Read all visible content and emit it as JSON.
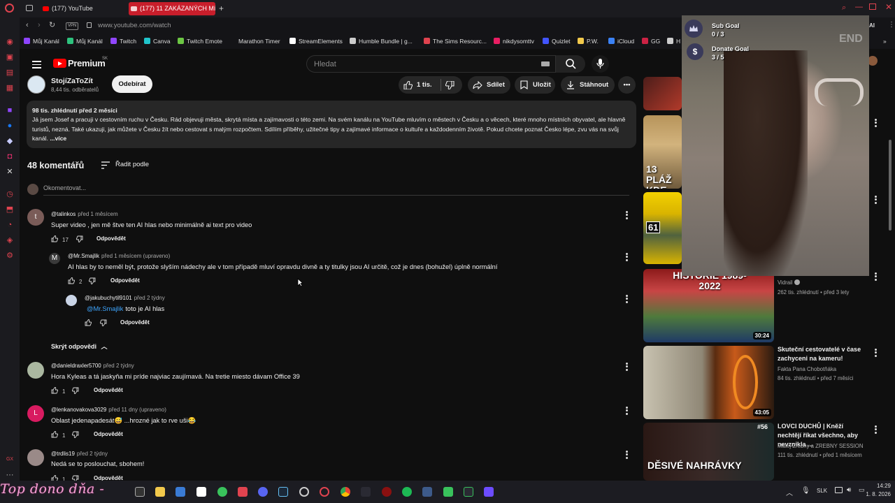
{
  "tabs": [
    {
      "label": "(177) YouTube"
    },
    {
      "label": "(177) 11 ZAKÁZANÝCH Míst"
    }
  ],
  "address": {
    "vpn": "VPN",
    "url": "www.youtube.com/watch",
    "ai": "AI"
  },
  "bookmarks": [
    {
      "label": "Můj Kanál",
      "color": "#8e44ff"
    },
    {
      "label": "Můj Kanál",
      "color": "#2ec27e"
    },
    {
      "label": "Twitch",
      "color": "#9146ff"
    },
    {
      "label": "Canva",
      "color": "#20c4cb"
    },
    {
      "label": "Twitch Emote",
      "color": "#6cc644"
    },
    {
      "label": "Marathon Timer",
      "color": "#141417"
    },
    {
      "label": "StreamElements",
      "color": "#ffffff"
    },
    {
      "label": "Humble Bundle | g...",
      "color": "#cccccc"
    },
    {
      "label": "The Sims Resourc...",
      "color": "#e0434f"
    },
    {
      "label": "nikdysomttv",
      "color": "#e91e63"
    },
    {
      "label": "Quizlet",
      "color": "#4255ff"
    },
    {
      "label": "P.W.",
      "color": "#f2c94c"
    },
    {
      "label": "iCloud",
      "color": "#3b82f6"
    },
    {
      "label": "GG",
      "color": "#cc2244"
    },
    {
      "label": "H",
      "color": "#cccccc"
    }
  ],
  "youtube": {
    "logo_text": "Premium",
    "logo_sup": "SK",
    "search_placeholder": "Hledat"
  },
  "channel": {
    "name": "StojíZaToZít",
    "subscribers": "8,44 tis. odběratelů",
    "subscribe_label": "Odebírat",
    "likes": "1 tis.",
    "share_label": "Sdílet",
    "save_label": "Uložit",
    "download_label": "Stáhnout"
  },
  "description": {
    "meta": "98 tis. zhlédnutí  před 2 měsíci",
    "text": "Já jsem Josef a pracuji v cestovním ruchu v Česku. Rád objevuji města, skrytá místa a zajímavosti o této zemi. Na svém kanálu na YouTube mluvím o městech v Česku a o věcech, které mnoho místních obyvatel, ale hlavně turistů, nezná. Také ukazuji, jak můžete v Česku žít nebo cestovat s malým rozpočtem. Sdílím příběhy, užitečné tipy a zajímavé informace o kultuře a každodenním životě. Pokud chcete poznat Česko lépe, zvu vás na svůj kanál.",
    "more": "...více"
  },
  "comments_header": {
    "count": "48 komentářů",
    "sort": "Řadit podle",
    "add_placeholder": "Okomentovat..."
  },
  "comments": [
    {
      "author": "@talinkos",
      "time": "před 1 měsícem",
      "text": "Super video , jen mě štve ten AI hlas nebo minimálně ai text pro video",
      "likes": "17",
      "reply": "Odpovědět",
      "avatar": "t",
      "avatar_color": "#7a5c58"
    },
    {
      "author": "@Mr.Smajlik",
      "time": "před 1 měsícem (upraveno)",
      "text": "AI hlas by to neměl být, protože slyším nádechy ale v tom případě mluví opravdu divně a ty titulky jsou AI určitě, což je dnes (bohužel) úplně normální",
      "likes": "2",
      "reply": "Odpovědět",
      "avatar": "M",
      "avatar_color": "#3a3a3a"
    },
    {
      "author": "@jakubuchytil9101",
      "time": "před 2 týdny",
      "mention": "@Mr.Smajlik",
      "text": "toto je AI hlas",
      "likes": "",
      "reply": "Odpovědět"
    },
    {
      "author": "@danieldraxler5700",
      "time": "před 2 týdny",
      "text": "Hora Kyleas a tá jaskyňa mi príde najviac zaujímavá. Na tretie miesto dávam Office 39",
      "likes": "1",
      "reply": "Odpovědět"
    },
    {
      "author": "@lenkanovakova3029",
      "time": "před 11 dny (upraveno)",
      "text": "Oblast jedenapadesát😅 ...hrozné jak to rve uši😂",
      "likes": "1",
      "reply": "Odpovědět",
      "avatar": "L",
      "avatar_color": "#d81b60"
    },
    {
      "author": "@trdlis19",
      "time": "před 2 týdny",
      "text": "Nedá se to poslouchat, sbohem!",
      "likes": "1",
      "reply": "Odpovědět"
    }
  ],
  "hide_replies": "Skrýt odpovědi",
  "sidebar_videos": [
    {
      "thumb_text": "13 PLÁŽ KDE SE NE"
    },
    {
      "thumb_text": "61"
    },
    {
      "thumb_text": "HISTORIE 1989-2022",
      "channel": "Vidrail",
      "meta": "262 tis. zhlédnutí • před 3 lety",
      "duration": "30:24"
    },
    {
      "title": "Skuteční cestovatelé v čase zachyceni na kameru!",
      "channel": "Fakta Pana Chobotňáka",
      "meta": "84 tis. zhlédnutí • před 7 měsíci",
      "duration": "43:05"
    },
    {
      "title": "LOVCI DUCHŮ | Kněží nechtějí říkat všechno, aby nevznikla ...",
      "channel": "Matej Zrebny a ZREBNY SESSION",
      "meta": "111 tis. zhlédnutí • před 1 měsícem",
      "thumb_text": "DĚSIVÉ NAHRÁVKY",
      "badge": "#56"
    }
  ],
  "overlay": {
    "sub_goal_label": "Sub Goal",
    "sub_goal_value": "0 / 3",
    "donate_goal_label": "Donate Goal",
    "donate_goal_value": "3 / 5",
    "sub_goal_progress": 0.0,
    "donate_goal_progress": 0.6
  },
  "taskbar": {
    "language": "SLK",
    "time": "14:29",
    "date": "1. 8. 2026"
  },
  "sticker_text": "Top dono dňa -"
}
